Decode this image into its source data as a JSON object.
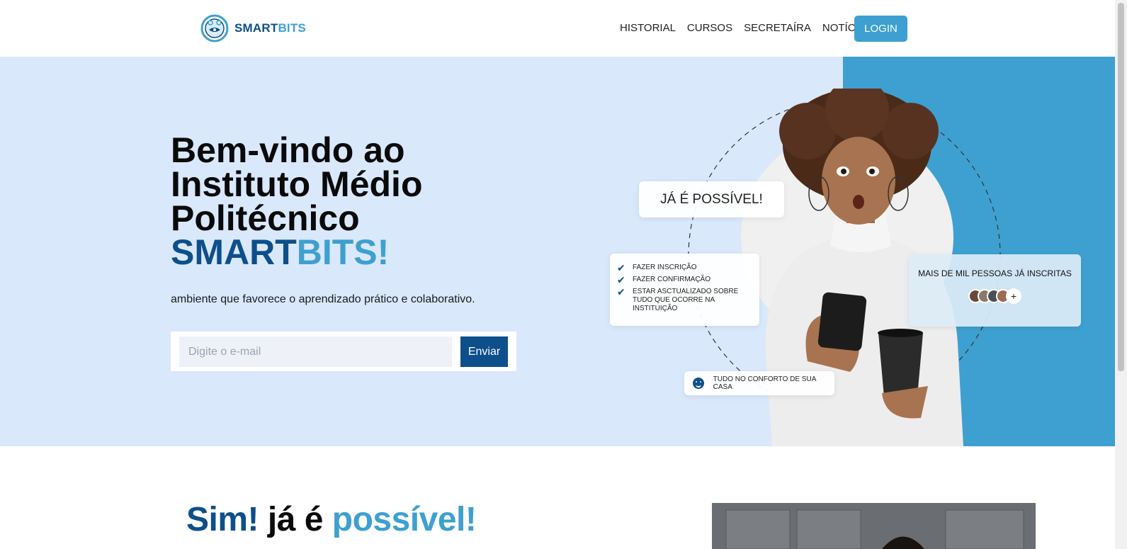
{
  "header": {
    "logo_part1": "SMART",
    "logo_part2": "BITS",
    "nav": [
      "HISTORIAL",
      "CURSOS",
      "SECRETAÍRA",
      "NOTÍCIAS"
    ],
    "login_label": "LOGIN"
  },
  "hero": {
    "title_line1": "Bem-vindo ao",
    "title_line2": "Instituto Médio",
    "title_line3": "Politécnico",
    "brand_part1": "SMART",
    "brand_part2": "BITS!",
    "subtitle": "ambiente que favorece o aprendizado prático e colaborativo.",
    "email_placeholder": "Digite o e-mail",
    "send_label": "Enviar"
  },
  "illustration": {
    "possible_card": "JÁ É POSSÍVEL!",
    "checklist": [
      "FAZER INSCRIÇÃO",
      "FAZER CONFIRMAÇÃO",
      "ESTAR ASCTUALIZADO SOBRE TUDO QUE OCORRE NA INSTITUIÇÃO"
    ],
    "people_card": "MAIS DE MIL PESSOAS JÁ INSCRITAS",
    "plus_symbol": "+",
    "comfort_card": "TUDO NO CONFORTO DE SUA CASA"
  },
  "section2": {
    "title_w1": "Sim!",
    "title_w2": "já é",
    "title_w3": "possível!"
  },
  "colors": {
    "brand_dark": "#0d4f8b",
    "brand_light": "#3ea0d0",
    "hero_bg": "#d9e8fb"
  }
}
